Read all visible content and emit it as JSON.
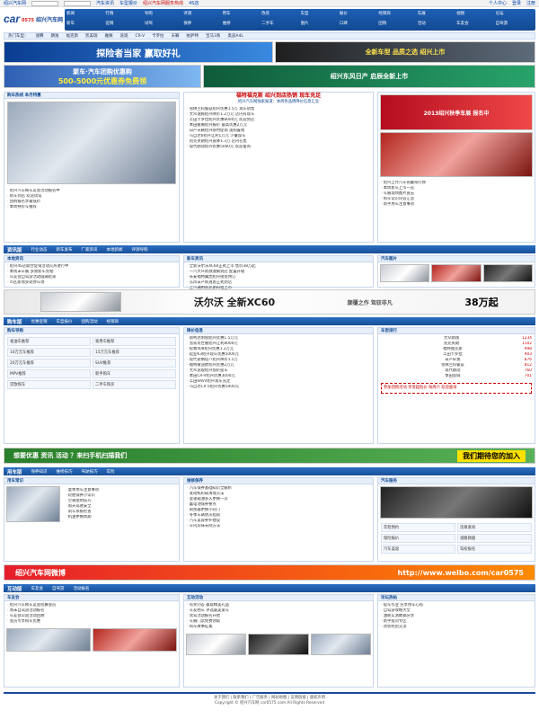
{
  "topbar": {
    "links": [
      "绍兴汽车网",
      "汽车资讯",
      "车型报价",
      "绍兴汽车网服务热线",
      "4S店",
      "个人中心",
      "登录",
      "注册"
    ]
  },
  "logo": {
    "mark": "car",
    "num": "0575",
    "cn": "绍兴汽车网"
  },
  "nav": {
    "items": [
      "新闻",
      "行情",
      "导购",
      "评测",
      "用车",
      "改装",
      "车型",
      "报价",
      "经销商",
      "车展",
      "视频",
      "论坛",
      "新车",
      "促销",
      "试驾",
      "保养",
      "维修",
      "二手车",
      "图片",
      "口碑",
      "团购",
      "活动",
      "车友会",
      "自驾游"
    ]
  },
  "subnav": {
    "items": [
      "热门车型：",
      "速腾",
      "朗逸",
      "福克斯",
      "凯美瑞",
      "雅阁",
      "途观",
      "CR-V",
      "卡罗拉",
      "天籁",
      "帕萨特",
      "宝马3系",
      "奥迪A4L"
    ]
  },
  "banners": {
    "b1": "探险者当家 赢取好礼",
    "b2": "全新车型 品质之选 绍兴上市",
    "b3_top": "聚车·汽车团购优惠购",
    "b3_big": "500-5000元优惠券免费领",
    "b4": "绍兴东风日产 启辰全新上市"
  },
  "left_promo": {
    "title": "购车热线 本月特惠",
    "items": [
      "绍兴汽车网车友会活动报名中",
      "新车到店 欢迎试驾",
      "团购报名享最低价",
      "本周特价车推荐"
    ]
  },
  "focus": {
    "headline": "福特福克斯 绍兴到店热销 现车充足",
    "sub": "绍兴汽车网独家报道：本周各品牌降价信息汇总",
    "items": [
      "雪佛兰科鲁兹绍兴优惠1.5万 现车销售",
      "大众速腾绍兴降价1.2万元 店内有现车",
      "丰田卡罗拉绍兴优惠8000元 欢迎到店",
      "本田雅阁绍兴报价 最高优惠2万元",
      "日产天籁绍兴限时促销 送购置税",
      "马自达6绍兴让利1万元 少量现车",
      "别克英朗绍兴直降1.3万 店内在售",
      "现代朗动绍兴优惠5000元 欢迎垂询"
    ]
  },
  "right_top": {
    "ad": "2013绍兴秋季车展 报名中",
    "list": [
      "绍兴上月汽车销量排行榜",
      "本周新车上市一览",
      "车展现场图片直击",
      "购车常识问答汇总",
      "新手用车注意事项"
    ]
  },
  "sections": {
    "news": {
      "title": "资讯版",
      "tabs": [
        "行业动态",
        "新车发布",
        "厂家资讯",
        "本地新闻",
        "评测导购"
      ]
    },
    "buy": {
      "title": "购车版",
      "tabs": [
        "优惠促销",
        "车型报价",
        "团购活动",
        "经销商"
      ]
    },
    "use": {
      "title": "用车版",
      "tabs": [
        "保养知识",
        "维修技巧",
        "驾驶技巧",
        "车险"
      ]
    },
    "fun": {
      "title": "互动版",
      "tabs": [
        "车友会",
        "自驾游",
        "活动报名"
      ]
    }
  },
  "news_left": {
    "head": "本地资讯",
    "items": [
      "绍兴4S店联合促销活动火热进行中",
      "本周末车展 多款新车亮相",
      "车友会自驾游活动圆满结束",
      "市区新增多处停车场"
    ]
  },
  "news_mid": {
    "head": "新车资讯",
    "items": [
      "全新沃尔沃XC60正式上市 售价38万起",
      "一汽大众新款速腾到店 配置升级",
      "长安福特翼虎绍兴接受预订",
      "东风日产新逍客正式到店",
      "上汽通用别克昂科拉上市",
      "广汽丰田凯美瑞混动版到店",
      "奇瑞艾瑞泽7绍兴上市",
      "吉利帝豪EC7全系优惠"
    ]
  },
  "news_right": {
    "head": "汽车图片",
    "items": [
      "新车实拍",
      "车展美女",
      "车型对比",
      "经典车型",
      "改装车"
    ]
  },
  "ad_volvo": {
    "left": "沃尔沃 全新XC60",
    "mid": "38万起",
    "right": "颠覆之作 驾驭非凡"
  },
  "buy_left": {
    "head": "购车导购",
    "items": [
      "省油车推荐",
      "家用车推荐",
      "10万元车推荐",
      "15万元车推荐",
      "20万元车推荐",
      "SUV推荐",
      "MPV推荐",
      "新手购车",
      "贷款购车",
      "二手车购买"
    ]
  },
  "buy_mid": {
    "head": "降价信息",
    "items": [
      "斯柯达明锐绍兴优惠1.5万元",
      "雪铁龙世嘉绍兴让利8000元",
      "标致408绍兴优惠1.2万元",
      "起亚K3绍兴现车优惠5000元",
      "现代索纳塔八绍兴降价1.5万",
      "福特蒙迪欧绍兴优惠2万元",
      "大众途观绍兴加价提车",
      "本田CR-V绍兴优惠3000元",
      "丰田RAV4绍兴现车充足",
      "马自达CX-5绍兴优惠5000元"
    ]
  },
  "buy_right": {
    "head": "车型排行",
    "rank": [
      [
        "大众朗逸",
        "1234"
      ],
      [
        "别克英朗",
        "1102"
      ],
      [
        "福特福克斯",
        "998"
      ],
      [
        "丰田卡罗拉",
        "903"
      ],
      [
        "日产轩逸",
        "876"
      ],
      [
        "雪佛兰科鲁兹",
        "812"
      ],
      [
        "现代朗动",
        "760"
      ],
      [
        "本田思域",
        "701"
      ]
    ],
    "promo": "参加团购活动 享受超低价 每周六 欢迎垂询"
  },
  "ad_green": {
    "left": "想要优惠 资讯 活动 ？来扫手机扫描我们",
    "right": "我们期待您的加入"
  },
  "use_left": {
    "head": "用车常识",
    "items": [
      "夏季用车注意事项",
      "轮胎保养小常识",
      "空调使用技巧",
      "雨天驾驶安全",
      "刹车系统检查",
      "机油更换周期"
    ]
  },
  "use_mid": {
    "head": "维修保养",
    "items": [
      "汽车保养基础知识全解析",
      "发动机积碳清理方法",
      "变速箱油多久更换一次",
      "蓄电池保养要点",
      "雨刮器更换小窍门",
      "冬季车辆防冻指南",
      "汽车美容养护建议",
      "车内异味去除方法"
    ]
  },
  "use_right": {
    "head": "汽车服务",
    "items": [
      "年检预约",
      "违章查询",
      "保险报价",
      "道路救援",
      "汽车美容",
      "驾校报名"
    ]
  },
  "ad_weibo": {
    "left": "绍兴汽车网微博",
    "right": "http://www.weibo.com/car0575"
  },
  "fun_left": {
    "head": "车友会",
    "items": [
      "绍兴汽车网车友会招募会员",
      "周末自驾游活动报名",
      "车友会公益活动回顾",
      "会员专享购车优惠"
    ]
  },
  "fun_mid": {
    "head": "互动活动",
    "items": [
      "有奖问答 赢取精美礼品",
      "车友晒车 评选最美爱车",
      "试驾活动报名开始",
      "车展门票免费领取",
      "购车故事征集"
    ]
  },
  "fun_right": {
    "head": "论坛热帖",
    "items": [
      "提车作业 分享用车心得",
      "自驾游攻略大全",
      "油耗实测数据分享",
      "新手提问专区",
      "改装经验交流"
    ]
  },
  "footer": {
    "line1": "关于我们 | 联系我们 | 广告服务 | 网站地图 | 友情链接 | 版权声明",
    "line2": "Copyright © 绍兴汽车网 car0575.com All Rights Reserved"
  }
}
